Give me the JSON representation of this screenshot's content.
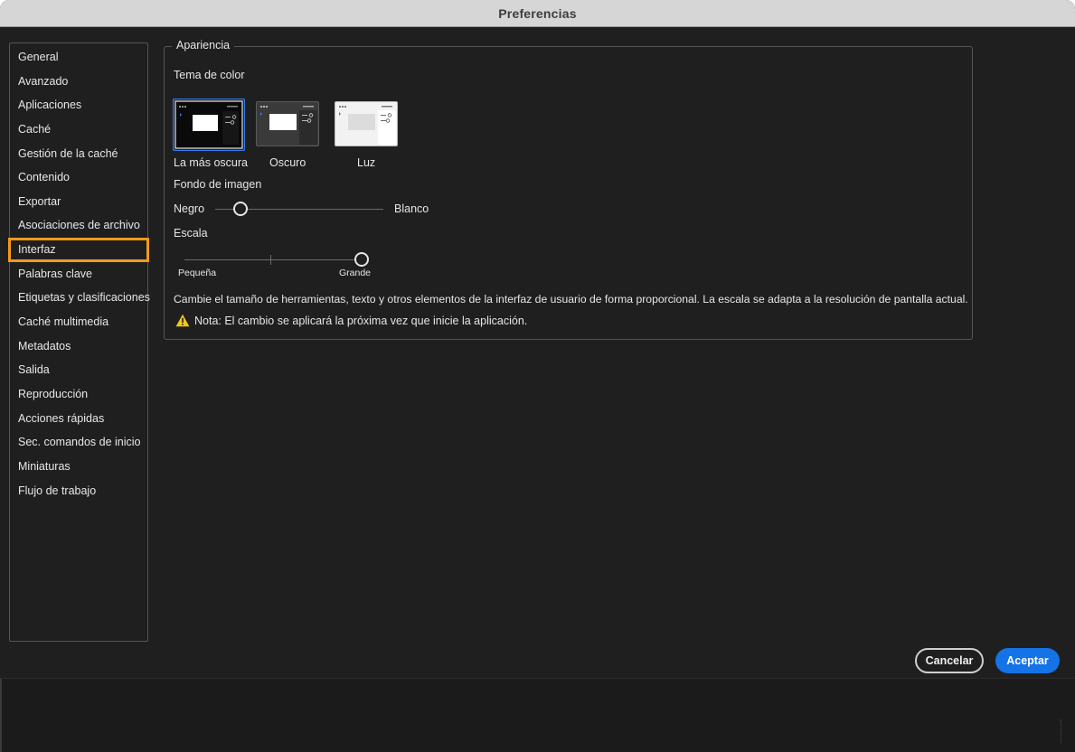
{
  "window": {
    "title": "Preferencias"
  },
  "sidebar": {
    "items": [
      {
        "label": "General"
      },
      {
        "label": "Avanzado"
      },
      {
        "label": "Aplicaciones"
      },
      {
        "label": "Caché"
      },
      {
        "label": "Gestión de la caché"
      },
      {
        "label": "Contenido"
      },
      {
        "label": "Exportar"
      },
      {
        "label": "Asociaciones de archivo"
      },
      {
        "label": "Interfaz"
      },
      {
        "label": "Palabras clave"
      },
      {
        "label": "Etiquetas y clasificaciones"
      },
      {
        "label": "Caché multimedia"
      },
      {
        "label": "Metadatos"
      },
      {
        "label": "Salida"
      },
      {
        "label": "Reproducción"
      },
      {
        "label": "Acciones rápidas"
      },
      {
        "label": "Sec. comandos de inicio"
      },
      {
        "label": "Miniaturas"
      },
      {
        "label": "Flujo de trabajo"
      }
    ],
    "selected": "Interfaz",
    "highlight_color": "#f39a1d"
  },
  "appearance": {
    "legend": "Apariencia",
    "color_theme_label": "Tema de color",
    "themes": [
      {
        "label": "La más oscura",
        "selected": true
      },
      {
        "label": "Oscuro",
        "selected": false
      },
      {
        "label": "Luz",
        "selected": false
      }
    ],
    "background_label": "Fondo de imagen",
    "background_min": "Negro",
    "background_max": "Blanco",
    "background_value_fraction": 0.12,
    "scale_label": "Escala",
    "scale_min": "Pequeña",
    "scale_max": "Grande",
    "scale_value_fraction": 1.0,
    "description": "Cambie el tamaño de herramientas, texto y otros elementos de la interfaz de usuario de forma proporcional. La escala se adapta a la resolución de pantalla actual.",
    "note": "Nota: El cambio se aplicará la próxima vez que inicie la aplicación."
  },
  "buttons": {
    "cancel": "Cancelar",
    "ok": "Aceptar"
  },
  "colors": {
    "accent": "#1473e6",
    "warning": "#f5c518",
    "selection": "#f39a1d"
  }
}
